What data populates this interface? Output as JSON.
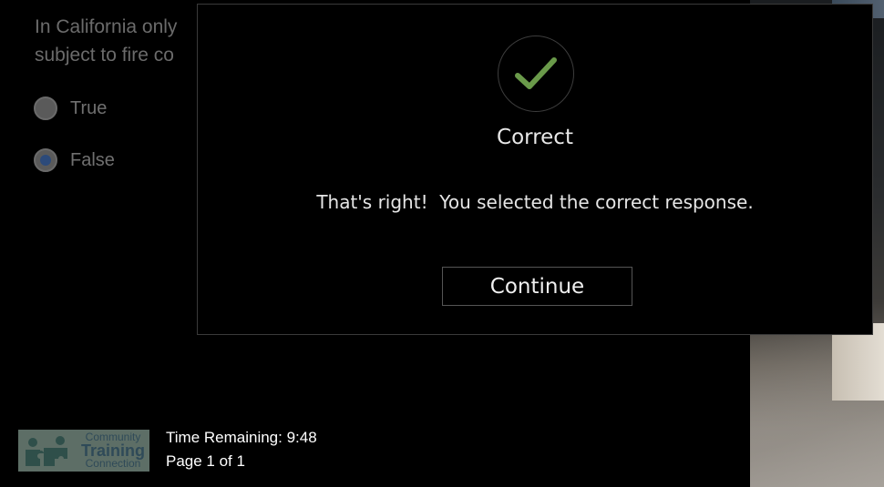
{
  "question": {
    "text": "In California only\nsubject to fire co",
    "options": [
      {
        "label": "True",
        "selected": false
      },
      {
        "label": "False",
        "selected": true
      }
    ]
  },
  "feedback_modal": {
    "icon": "checkmark-icon",
    "icon_color": "#6a9a4a",
    "title": "Correct",
    "message": "That's right!  You selected the correct response.",
    "continue_label": "Continue"
  },
  "footer": {
    "logo": {
      "line1": "Community",
      "line2": "Training",
      "line3": "Connection"
    },
    "time_remaining": "Time Remaining: 9:48",
    "page": "Page 1 of 1"
  }
}
